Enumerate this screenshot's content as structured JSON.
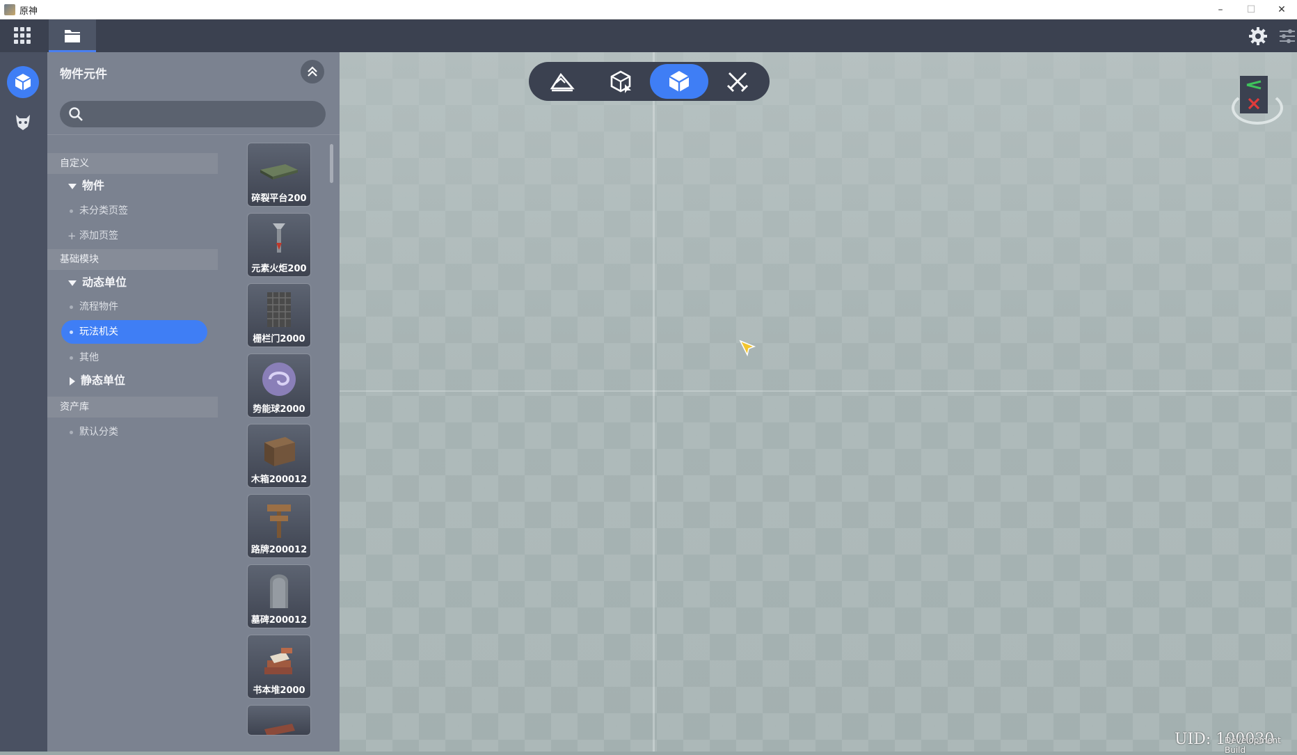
{
  "window": {
    "title": "原神",
    "minimize": "–",
    "maximize": "☐",
    "close": "✕"
  },
  "topbar": {
    "apps_icon": "grid-icon",
    "active_tab_icon": "folder-icon",
    "settings_icon": "gear-icon",
    "adjust_icon": "sliders-icon"
  },
  "rail": {
    "items": [
      {
        "icon": "cube-icon",
        "active": true
      },
      {
        "icon": "creature-icon",
        "active": false
      }
    ]
  },
  "panel": {
    "title": "物件元件",
    "search": {
      "value": "",
      "placeholder": ""
    },
    "tree": {
      "custom": {
        "label": "自定义",
        "group": "物件",
        "items": [
          "未分类页签",
          "添加页签"
        ]
      },
      "basic": {
        "label": "基础模块",
        "group_dynamic": "动态单位",
        "dynamic_items": [
          "流程物件",
          "玩法机关",
          "其他"
        ],
        "group_static": "静态单位"
      },
      "assets": {
        "label": "资产库",
        "items": [
          "默认分类"
        ]
      }
    },
    "selected_item": "玩法机关",
    "thumbnails": [
      {
        "label": "碎裂平台200"
      },
      {
        "label": "元素火炬200"
      },
      {
        "label": "栅栏门2000"
      },
      {
        "label": "势能球2000"
      },
      {
        "label": "木箱200012"
      },
      {
        "label": "路牌200012"
      },
      {
        "label": "墓碑200012"
      },
      {
        "label": "书本堆2000"
      },
      {
        "label": ""
      }
    ]
  },
  "modebar": {
    "modes": [
      {
        "icon": "terrain-icon",
        "active": false
      },
      {
        "icon": "wireframe-cube-icon",
        "active": false
      },
      {
        "icon": "solid-cube-icon",
        "active": true
      },
      {
        "icon": "crossed-swords-icon",
        "active": false
      }
    ]
  },
  "viewport": {
    "uid": "UID: 100030",
    "build": "Development Build"
  },
  "colors": {
    "accent": "#3f7ef5",
    "topbar": "#3b4150",
    "panel": "#7b8290"
  }
}
